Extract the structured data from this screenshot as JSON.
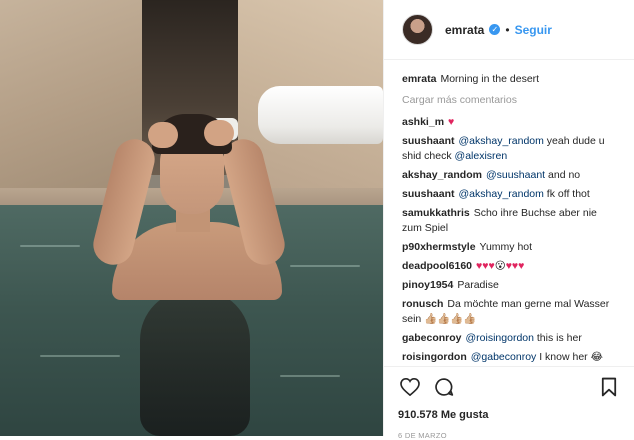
{
  "header": {
    "username": "emrata",
    "separator": "•",
    "follow_label": "Seguir",
    "verified_glyph": "✓"
  },
  "caption": {
    "username": "emrata",
    "text": "Morning in the desert"
  },
  "load_more_label": "Cargar más comentarios",
  "comments": [
    {
      "user": "ashki_m",
      "parts": [
        {
          "text": "♥",
          "type": "heart"
        }
      ]
    },
    {
      "user": "suushaant",
      "parts": [
        {
          "text": "@akshay_random",
          "type": "mention"
        },
        {
          "text": " yeah dude u shid check ",
          "type": "text"
        },
        {
          "text": "@alexisren",
          "type": "mention"
        }
      ]
    },
    {
      "user": "akshay_random",
      "parts": [
        {
          "text": "@suushaant",
          "type": "mention"
        },
        {
          "text": " and no",
          "type": "text"
        }
      ]
    },
    {
      "user": "suushaant",
      "parts": [
        {
          "text": "@akshay_random",
          "type": "mention"
        },
        {
          "text": " fk off thot",
          "type": "text"
        }
      ]
    },
    {
      "user": "samukkathris",
      "parts": [
        {
          "text": "Scho ihre Buchse aber nie zum Spiel",
          "type": "text"
        }
      ]
    },
    {
      "user": "p90xhermstyle",
      "parts": [
        {
          "text": "Yummy hot",
          "type": "text"
        }
      ]
    },
    {
      "user": "deadpool6160",
      "parts": [
        {
          "text": "♥♥♥",
          "type": "heart"
        },
        {
          "text": "😮",
          "type": "text"
        },
        {
          "text": "♥♥♥",
          "type": "heart"
        }
      ]
    },
    {
      "user": "pinoy1954",
      "parts": [
        {
          "text": "Paradise",
          "type": "text"
        }
      ]
    },
    {
      "user": "ronusch",
      "parts": [
        {
          "text": "Da möchte man gerne mal Wasser sein 👍🏼👍🏼👍🏼👍🏼",
          "type": "text"
        }
      ]
    },
    {
      "user": "gabeconroy",
      "parts": [
        {
          "text": "@roisingordon",
          "type": "mention"
        },
        {
          "text": " this is her",
          "type": "text"
        }
      ]
    },
    {
      "user": "roisingordon",
      "parts": [
        {
          "text": "@gabeconroy",
          "type": "mention"
        },
        {
          "text": " I know her 😂",
          "type": "text"
        }
      ]
    }
  ],
  "likes_count": "910.578",
  "likes_label": "Me gusta",
  "date": "6 DE MARZO",
  "colors": {
    "accent": "#3897f0",
    "mention": "#003569",
    "heart": "#e0245e",
    "muted": "#999999"
  },
  "icons": [
    "heart-icon",
    "comment-icon",
    "bookmark-icon",
    "verified-badge-icon"
  ]
}
